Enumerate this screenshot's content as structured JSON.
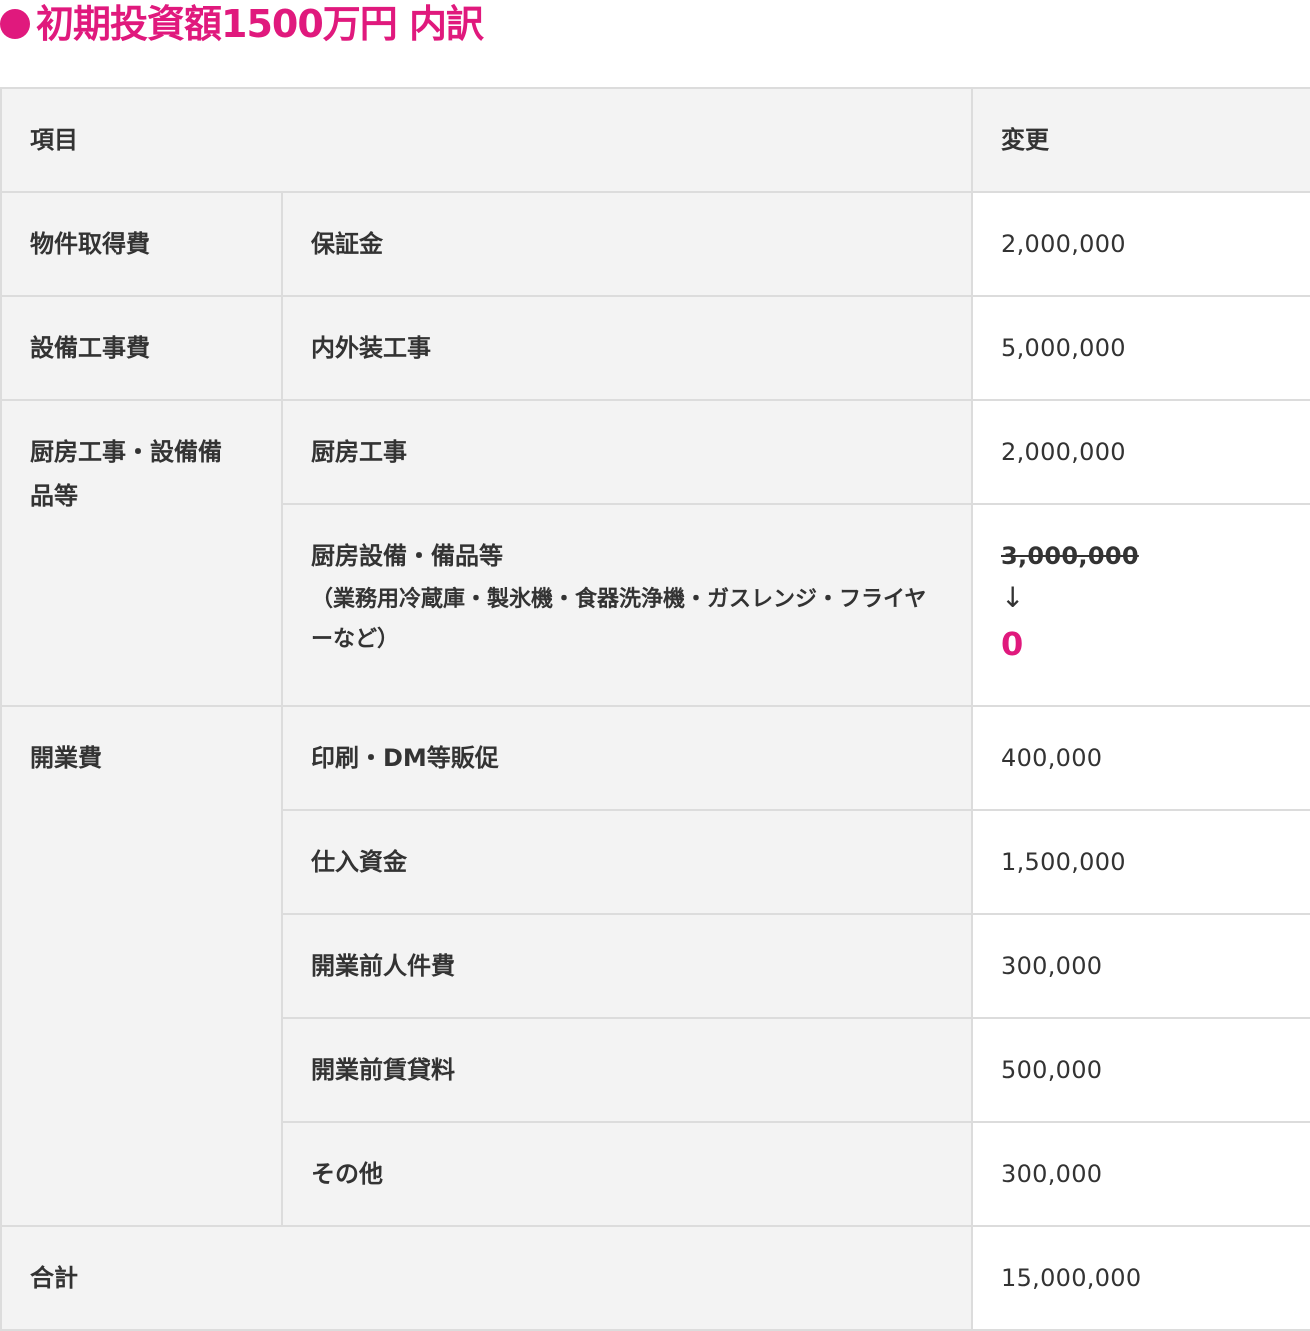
{
  "title": {
    "bullet": "●",
    "text": "初期投資額1500万円 内訳",
    "accent_color": "#e0197d"
  },
  "table": {
    "headers": {
      "item": "項目",
      "change": "変更"
    },
    "groups": {
      "property": {
        "label": "物件取得費",
        "rows": [
          {
            "label": "保証金",
            "value": "2,000,000"
          }
        ]
      },
      "facility": {
        "label": "設備工事費",
        "rows": [
          {
            "label": "内外装工事",
            "value": "5,000,000"
          }
        ]
      },
      "kitchen": {
        "label": "厨房工事・設備備品等",
        "rows": [
          {
            "label": "厨房工事",
            "value": "2,000,000"
          },
          {
            "label": "厨房設備・備品等",
            "note": "（業務用冷蔵庫・製氷機・食器洗浄機・ガスレンジ・フライヤーなど）",
            "old_value": "3,000,000",
            "arrow": "↓",
            "new_value": "0"
          }
        ]
      },
      "opening": {
        "label": "開業費",
        "rows": [
          {
            "label": "印刷・DM等販促",
            "value": "400,000"
          },
          {
            "label": "仕入資金",
            "value": "1,500,000"
          },
          {
            "label": "開業前人件費",
            "value": "300,000"
          },
          {
            "label": "開業前賃貸料",
            "value": "500,000"
          },
          {
            "label": "その他",
            "value": "300,000"
          }
        ]
      }
    },
    "total": {
      "label": "合計",
      "value": "15,000,000"
    }
  }
}
